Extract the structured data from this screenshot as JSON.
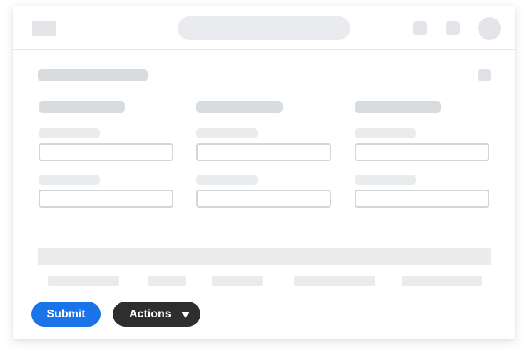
{
  "form": {
    "columns": [
      {
        "fields": [
          "",
          ""
        ]
      },
      {
        "fields": [
          "",
          ""
        ]
      },
      {
        "fields": [
          "",
          ""
        ]
      }
    ]
  },
  "actions": {
    "submit_label": "Submit",
    "actions_label": "Actions",
    "actions_icon": "caret-down-icon"
  },
  "colors": {
    "primary": "#1a73e8",
    "dark_button": "#2e2e2e",
    "placeholder": "#e3e5e8"
  }
}
